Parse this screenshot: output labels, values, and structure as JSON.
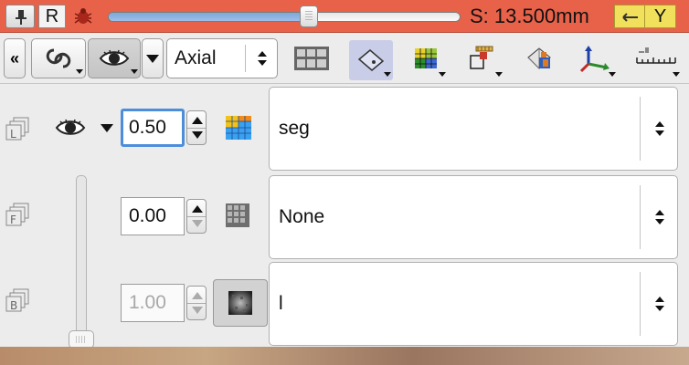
{
  "slice_controller": {
    "view_letter": "R",
    "offset_readout": "S: 13.500mm",
    "axis_letter": "Y",
    "slider_position": 0.57,
    "bar_color": "#e8624a",
    "link_color": "#f1e05c",
    "icons": {
      "pin": "pin-icon",
      "bug": "bug-icon",
      "link": "link-arrow-icon"
    }
  },
  "toolbar": {
    "collapse_label": "«",
    "orientation": "Axial",
    "icons": [
      "link-rings-icon",
      "eye-icon",
      "layout-grid-icon",
      "slice-plane-icon",
      "label-grid-icon",
      "crop-icon",
      "volume-render-icon",
      "axes-icon",
      "ruler-icon"
    ]
  },
  "layers": [
    {
      "letter": "L",
      "opacity": "0.50",
      "volume": "seg",
      "grid_icon": "label-grid-icon"
    },
    {
      "letter": "F",
      "opacity": "0.00",
      "volume": "None",
      "grid_icon": "foreground-grid-icon"
    },
    {
      "letter": "B",
      "opacity": "1.00",
      "volume": "l",
      "grid_icon": "background-noise-icon"
    }
  ]
}
